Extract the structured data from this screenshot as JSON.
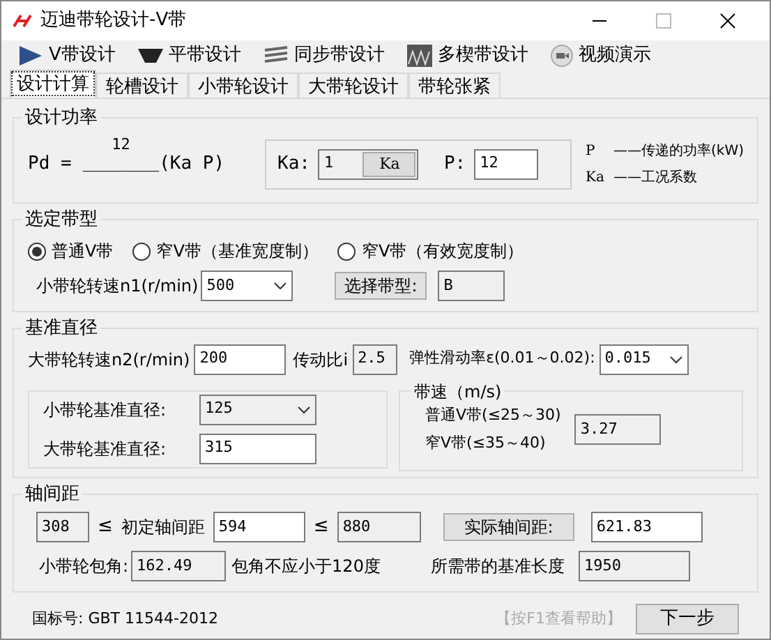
{
  "window": {
    "title": "迈迪带轮设计-V带"
  },
  "toolbar": [
    {
      "label": "V带设计"
    },
    {
      "label": "平带设计"
    },
    {
      "label": "同步带设计"
    },
    {
      "label": "多楔带设计"
    },
    {
      "label": "视频演示"
    }
  ],
  "tabs": [
    {
      "label": "设计计算",
      "selected": true
    },
    {
      "label": "轮槽设计",
      "selected": false
    },
    {
      "label": "小带轮设计",
      "selected": false
    },
    {
      "label": "大带轮设计",
      "selected": false
    },
    {
      "label": "带轮张紧",
      "selected": false
    }
  ],
  "power": {
    "legend": "设计功率",
    "formula_lhs": "Pd =",
    "numerator": "12",
    "fraction_line": "_______",
    "formula_rhs": "(Ka P)",
    "ka": {
      "label": "Ka:",
      "value": "1",
      "button": "Ka"
    },
    "p": {
      "label": "P:",
      "value": "12"
    },
    "notes": [
      {
        "symbol": "P",
        "text": "——传递的功率(kW)"
      },
      {
        "symbol": "Ka",
        "text": "——工况系数"
      }
    ]
  },
  "belt_type": {
    "legend": "选定带型",
    "options": [
      {
        "label": "普通V带",
        "selected": true
      },
      {
        "label": "窄V带（基准宽度制）",
        "selected": false
      },
      {
        "label": "窄V带（有效宽度制）",
        "selected": false
      }
    ],
    "speed": {
      "label": "小带轮转速n1(r/min)",
      "field": {
        "value": "500",
        "kind": "dropdown",
        "readonly": false
      }
    },
    "type_button": "选择带型:",
    "type_field": {
      "value": "B",
      "kind": "text",
      "readonly": true
    }
  },
  "diameter": {
    "legend": "基准直径",
    "n2": {
      "label": "大带轮转速n2(r/min)",
      "field": {
        "value": "200",
        "kind": "text",
        "readonly": false
      }
    },
    "ratio": {
      "label": "传动比i",
      "field": {
        "value": "2.5",
        "kind": "text",
        "readonly": true
      }
    },
    "slip": {
      "label": "弹性滑动率ε(0.01～0.02):",
      "field": {
        "value": "0.015",
        "kind": "dropdown",
        "readonly": false
      }
    },
    "small": {
      "label": "小带轮基准直径:",
      "field": {
        "value": "125",
        "kind": "dropdown",
        "readonly": true
      }
    },
    "large": {
      "label": "大带轮基准直径:",
      "field": {
        "value": "315",
        "kind": "text",
        "readonly": false
      }
    },
    "belt_speed": {
      "legend": "带速（m/s)",
      "lines": [
        "普通V带(≤25～30)",
        "窄V带(≤35～40)"
      ],
      "field": {
        "value": "3.27",
        "kind": "text",
        "readonly": true
      }
    }
  },
  "center": {
    "legend": "轴间距",
    "min": {
      "value": "308",
      "kind": "text",
      "readonly": true
    },
    "sign_1": "≤",
    "label": "初定轴间距",
    "initial": {
      "value": "594",
      "kind": "text",
      "readonly": false
    },
    "sign_2": "≤",
    "max": {
      "value": "880",
      "kind": "text",
      "readonly": true
    },
    "actual_button": "实际轴间距:",
    "actual": {
      "value": "621.83",
      "kind": "text",
      "readonly": false
    },
    "angle_label": "小带轮包角:",
    "angle": {
      "value": "162.49",
      "kind": "text",
      "readonly": true
    },
    "angle_note": "包角不应小于120度",
    "length_label": "所需带的基准长度",
    "length": {
      "value": "1950",
      "kind": "text",
      "readonly": true
    }
  },
  "footer": {
    "standard": "国标号: GBT 11544-2012",
    "help": "【按F1查看帮助】",
    "next": "下一步"
  }
}
